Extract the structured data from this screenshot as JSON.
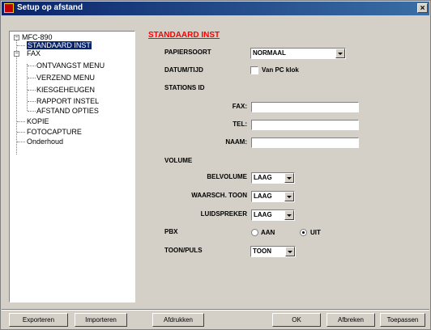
{
  "window": {
    "title": "Setup op afstand",
    "close": "×"
  },
  "tree": {
    "root": "MFC-890",
    "items": [
      "STANDAARD INST",
      "FAX",
      "ONTVANGST MENU",
      "VERZEND MENU",
      "KIESGEHEUGEN",
      "RAPPORT INSTEL",
      "AFSTAND OPTIES",
      "KOPIE",
      "FOTOCAPTURE",
      "Onderhoud"
    ],
    "expander_minus": "−"
  },
  "panel": {
    "title": "STANDAARD INST",
    "papiersoort": {
      "label": "PAPIERSOORT",
      "value": "NORMAAL"
    },
    "datumtijd": {
      "label": "DATUM/TIJD",
      "checkbox_label": "Van PC klok"
    },
    "stations_id": {
      "label": "STATIONS ID",
      "fax_label": "FAX:",
      "fax_value": "",
      "tel_label": "TEL:",
      "tel_value": "",
      "naam_label": "NAAM:",
      "naam_value": ""
    },
    "volume": {
      "label": "VOLUME",
      "belvolume_label": "BELVOLUME",
      "belvolume_value": "LAAG",
      "waarsch_label": "WAARSCH. TOON",
      "waarsch_value": "LAAG",
      "luidspreker_label": "LUIDSPREKER",
      "luidspreker_value": "LAAG"
    },
    "pbx": {
      "label": "PBX",
      "aan": "AAN",
      "uit": "UIT",
      "selected": "UIT"
    },
    "toonpuls": {
      "label": "TOON/PULS",
      "value": "TOON"
    }
  },
  "buttons": {
    "exporteren": "Exporteren",
    "importeren": "Importeren",
    "afdrukken": "Afdrukken",
    "ok": "OK",
    "afbreken": "Afbreken",
    "toepassen": "Toepassen"
  }
}
